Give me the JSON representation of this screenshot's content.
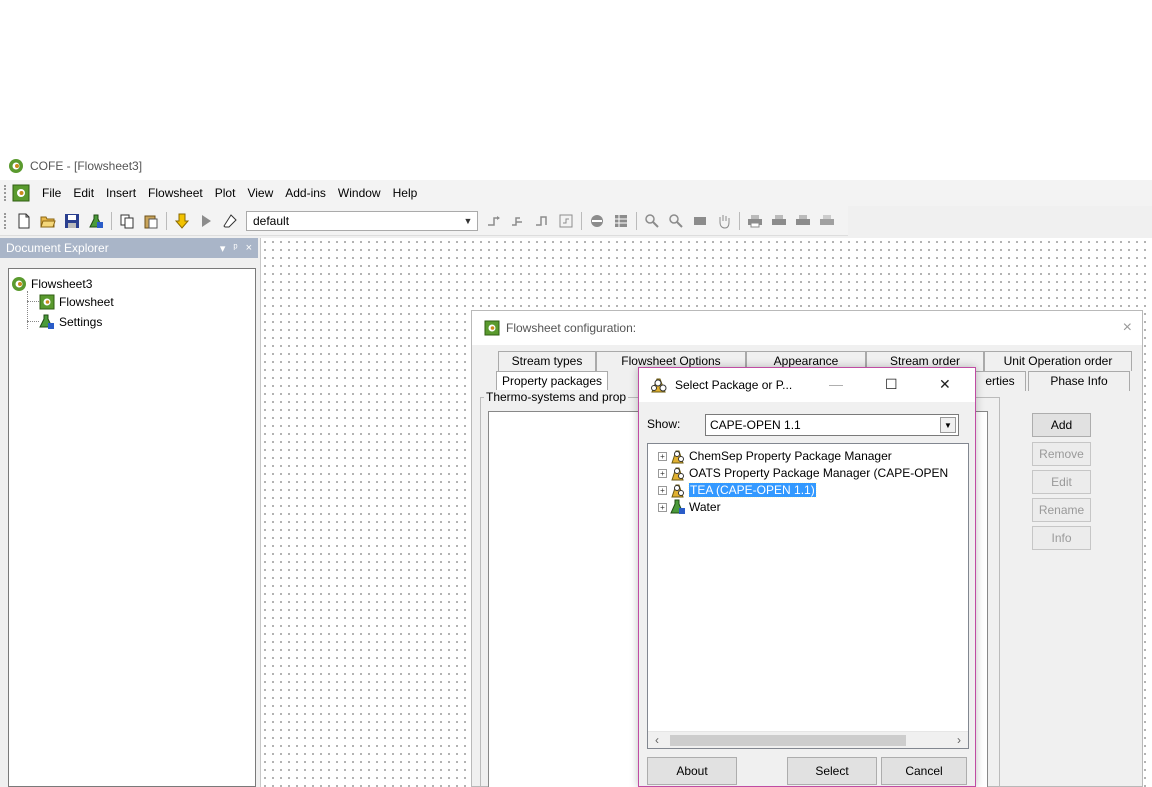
{
  "app": {
    "title": "COFE - [Flowsheet3]",
    "menu": [
      "File",
      "Edit",
      "Insert",
      "Flowsheet",
      "Plot",
      "View",
      "Add-ins",
      "Window",
      "Help"
    ],
    "toolbar_combo_value": "default"
  },
  "explorer": {
    "title": "Document Explorer",
    "header_buttons": [
      "▾",
      "ᵖ",
      "×"
    ],
    "tree": {
      "root": "Flowsheet3",
      "children": [
        "Flowsheet",
        "Settings"
      ]
    }
  },
  "config_dialog": {
    "title": "Flowsheet configuration:",
    "close": "×",
    "tabs_row1": [
      "Stream types",
      "Flowsheet Options",
      "Appearance",
      "Stream order",
      "Unit Operation order"
    ],
    "tabs_row2": [
      "Property packages",
      "erties",
      "Phase Info"
    ],
    "group_label": "Thermo-systems and prop",
    "buttons": [
      {
        "label": "Add",
        "enabled": true
      },
      {
        "label": "Remove",
        "enabled": false
      },
      {
        "label": "Edit",
        "enabled": false
      },
      {
        "label": "Rename",
        "enabled": false
      },
      {
        "label": "Info",
        "enabled": false
      }
    ]
  },
  "select_dialog": {
    "title": "Select Package or P...",
    "show_label": "Show:",
    "show_value": "CAPE-OPEN 1.1",
    "packages": [
      {
        "label": "ChemSep Property Package Manager",
        "selected": false
      },
      {
        "label": "OATS Property Package Manager (CAPE-OPEN",
        "selected": false
      },
      {
        "label": "TEA (CAPE-OPEN 1.1)",
        "selected": true
      },
      {
        "label": "Water",
        "selected": false
      }
    ],
    "buttons": [
      "About",
      "Select",
      "Cancel"
    ],
    "window_controls": [
      "—",
      "☐",
      "✕"
    ]
  },
  "colors": {
    "accent_selection": "#3399ff",
    "dialog_border": "#c04ca3",
    "dock_header": "#a9b5c8"
  }
}
